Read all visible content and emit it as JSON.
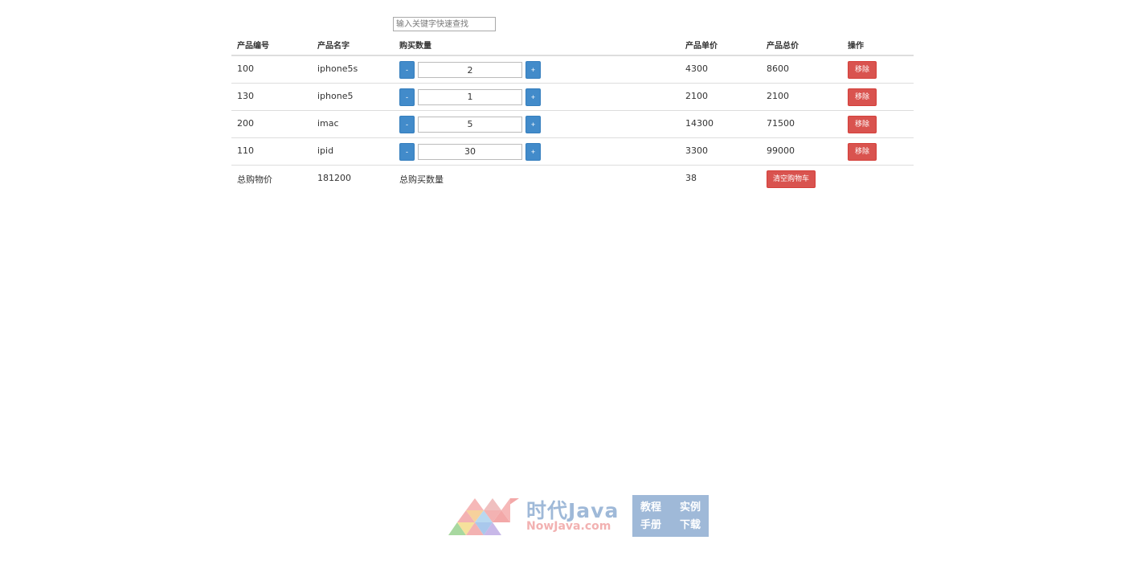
{
  "search": {
    "placeholder": "输入关键字快速查找",
    "value": ""
  },
  "table": {
    "headers": [
      "产品编号",
      "产品名字",
      "购买数量",
      "产品单价",
      "产品总价",
      "操作"
    ],
    "rows": [
      {
        "id": "100",
        "name": "iphone5s",
        "qty": "2",
        "price": "4300",
        "total": "8600"
      },
      {
        "id": "130",
        "name": "iphone5",
        "qty": "1",
        "price": "2100",
        "total": "2100"
      },
      {
        "id": "200",
        "name": "imac",
        "qty": "5",
        "price": "14300",
        "total": "71500"
      },
      {
        "id": "110",
        "name": "ipid",
        "qty": "30",
        "price": "3300",
        "total": "99000"
      }
    ],
    "minus_label": "-",
    "plus_label": "+",
    "remove_label": "移除"
  },
  "summary": {
    "total_price_label": "总购物价",
    "total_price": "181200",
    "total_qty_label": "总购买数量",
    "total_qty": "38",
    "clear_label": "清空购物车"
  },
  "watermark": {
    "title": "时代Java",
    "subtitle": "NowJava.com",
    "links": [
      "教程",
      "实例",
      "手册",
      "下载"
    ]
  },
  "colors": {
    "primary": "#428bca",
    "danger": "#d9534f",
    "watermark_blue": "#9fb9d8",
    "watermark_pink": "#f2b1b1"
  }
}
